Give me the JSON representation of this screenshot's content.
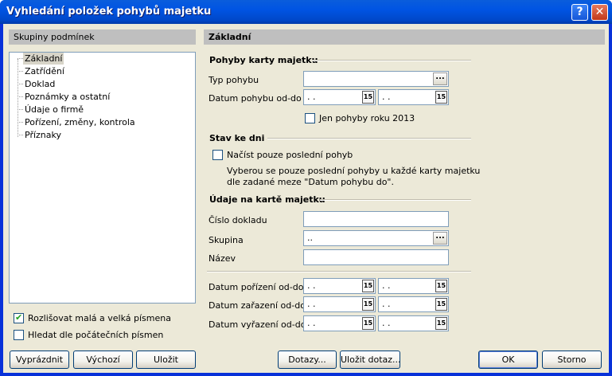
{
  "window": {
    "title": "Vyhledání položek pohybů majetku"
  },
  "left": {
    "header": "Skupiny podmínek",
    "tree": [
      "Základní",
      "Zatřídění",
      "Doklad",
      "Poznámky a ostatní",
      "Údaje o firmě",
      "Pořízení, změny, kontrola",
      "Příznaky"
    ],
    "check_case": "Rozlišovat malá a velká písmena",
    "check_start": "Hledat dle počátečních písmen"
  },
  "right": {
    "header": "Základní",
    "sec1": "Pohyby karty majetku",
    "typ_label": "Typ pohybu",
    "typ_value": "",
    "datum_label": "Datum pohybu od-do",
    "date_placeholder": " .  .",
    "only_year": "Jen pohyby roku 2013",
    "sec2": "Stav ke dni",
    "last_move": "Načíst pouze poslední pohyb",
    "note1": "Vyberou se pouze poslední pohyby u každé karty majetku",
    "note2": "dle zadané meze \"Datum pohybu do\".",
    "sec3": "Údaje na kartě majetku",
    "doc_label": "Číslo dokladu",
    "group_label": "Skupina",
    "group_value": "..",
    "name_label": "Název",
    "acq_label": "Datum pořízení od-do",
    "incl_label": "Datum zařazení od-do",
    "excl_label": "Datum vyřazení od-do"
  },
  "buttons": {
    "clear": "Vyprázdnit",
    "default": "Výchozí",
    "save": "Uložit",
    "queries": "Dotazy...",
    "save_query": "Uložit dotaz...",
    "ok": "OK",
    "cancel": "Storno"
  },
  "icons": {
    "help": "?",
    "close": "✕",
    "ellipsis": "...",
    "calendar": "15"
  }
}
